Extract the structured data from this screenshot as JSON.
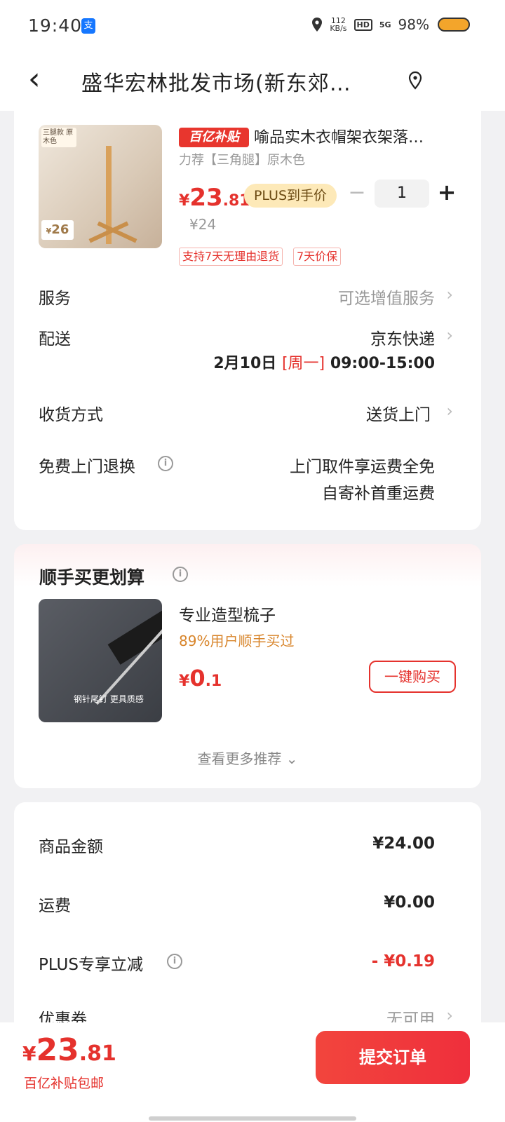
{
  "status_bar": {
    "time": "19:40",
    "net_speed_value": "112",
    "net_speed_unit": "KB/s",
    "hd_label": "HD",
    "signal_label": "5G",
    "battery": "98%"
  },
  "nav": {
    "back_icon": "‹",
    "title": "盛华宏林批发市场(新东郊…",
    "location_icon": "location-pin"
  },
  "product": {
    "subsidy_badge": "百亿补贴",
    "title": "喻品实木衣帽架衣架落…",
    "spec": "力荐【三角腿】原木色",
    "price_currency": "¥",
    "price_int": "23",
    "price_dec": ".81",
    "plus_label": "PLUS到手价",
    "original_price": "¥24",
    "quantity": "1",
    "service_tags": [
      "支持7天无理由退货",
      "7天价保"
    ],
    "image_tag": "三腿款 原木色",
    "image_price": "26"
  },
  "rows": {
    "service_label": "服务",
    "service_value": "可选增值服务",
    "delivery_label": "配送",
    "delivery_value": "京东快递",
    "delivery_date": "2月10日",
    "delivery_weekday": "[周一]",
    "delivery_time": "09:00-15:00",
    "receive_label": "收货方式",
    "receive_value": "送货上门",
    "return_label": "免费上门退换",
    "return_value_line1": "上门取件享运费全免",
    "return_value_line2": "自寄补首重运费"
  },
  "recommend": {
    "title": "顺手买更划算",
    "item_name": "专业造型梳子",
    "item_stat": "89%用户顺手买过",
    "price_currency": "¥",
    "price_int": "0",
    "price_dec": ".1",
    "buy_label": "一键购买",
    "image_caption": "钢针尾钉  更具质感",
    "more_label": "查看更多推荐"
  },
  "summary": {
    "goods_label": "商品金额",
    "goods_value": "¥24.00",
    "shipping_label": "运费",
    "shipping_value": "¥0.00",
    "plus_label": "PLUS专享立减",
    "plus_value": "- ¥0.19",
    "coupon_label": "优惠券",
    "coupon_value": "无可用"
  },
  "bottom": {
    "total_currency": "¥",
    "total_int": "23",
    "total_dec": ".81",
    "note": "百亿补贴包邮",
    "submit_label": "提交订单"
  },
  "colors": {
    "accent_red": "#e5322d",
    "plus_gold": "#fde9b8",
    "stat_orange": "#d8852b"
  }
}
